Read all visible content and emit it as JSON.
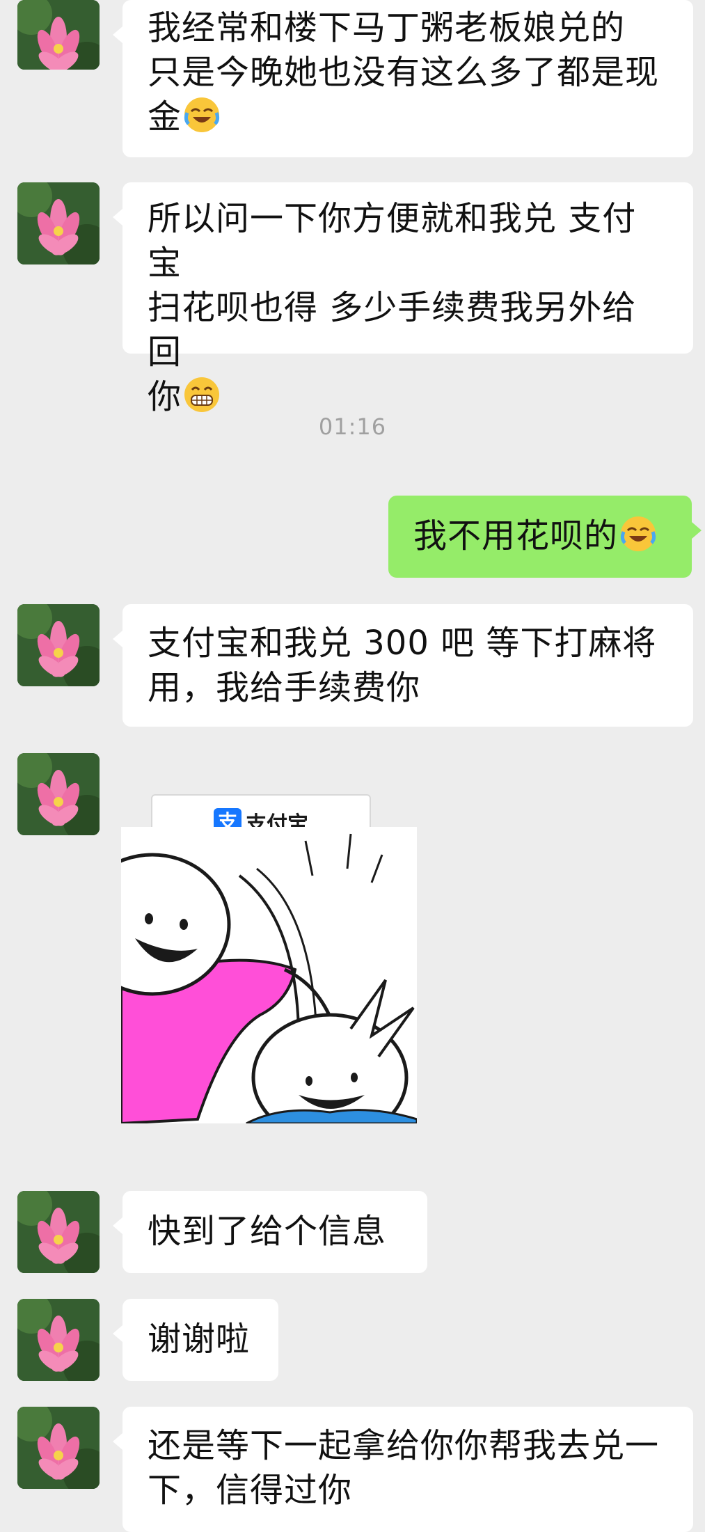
{
  "messages": [
    {
      "side": "left",
      "lines": [
        "我经常和楼下马丁粥老板娘兑的",
        "只是今晚她也没有这么多了都是现",
        "金"
      ],
      "emoji": "laughing-crying-emoji"
    },
    {
      "side": "left",
      "lines": [
        "所以问一下你方便就和我兑 支付宝",
        "扫花呗也得 多少手续费我另外给回",
        "你"
      ],
      "emoji": "grinning-emoji"
    },
    {
      "side": "right",
      "lines": [
        "我不用花呗的"
      ],
      "emoji": "laughing-crying-emoji"
    },
    {
      "side": "left",
      "lines": [
        "支付宝和我兑 300 吧 等下打麻将",
        "用，我给手续费你"
      ]
    },
    {
      "side": "left",
      "lines": [
        "快到了给个信息"
      ]
    },
    {
      "side": "left",
      "lines": [
        "谢谢啦"
      ]
    },
    {
      "side": "left",
      "lines": [
        "还是等下一起拿给你你帮我去兑一",
        "下，信得过你"
      ]
    }
  ],
  "timestamp": "01:16",
  "alipay_card": {
    "logo_glyph": "支",
    "brand": "支付宝"
  },
  "colors": {
    "background": "#ededed",
    "incoming_bubble": "#ffffff",
    "outgoing_bubble": "#95ec69",
    "alipay_blue": "#1677ff",
    "sticker_pink": "#ff4fd8"
  }
}
